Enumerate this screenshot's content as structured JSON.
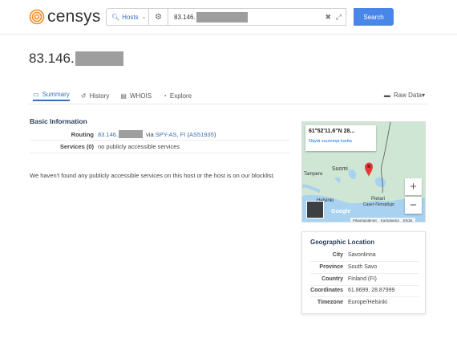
{
  "header": {
    "logo_text": "censys",
    "search_type": "Hosts",
    "query_prefix": "83.146.",
    "search_button": "Search"
  },
  "host": {
    "title_prefix": "83.146."
  },
  "tabs": [
    {
      "label": "Summary",
      "icon": "monitor-icon"
    },
    {
      "label": "History",
      "icon": "history-icon"
    },
    {
      "label": "WHOIS",
      "icon": "whois-icon"
    },
    {
      "label": "Explore",
      "icon": "binoculars-icon"
    }
  ],
  "raw_data": "Raw Data",
  "basic_info": {
    "title": "Basic Information",
    "routing_label": "Routing",
    "routing_ip_prefix": "83.146.",
    "routing_via": "via",
    "routing_asn_name": "SPY-AS, FI",
    "routing_asn_open": "(",
    "routing_asn": "AS51935",
    "routing_asn_close": ")",
    "services_label": "Services (0)",
    "services_value": "no publicly accessible services",
    "notice": "We haven't found any publicly accessible services on this host or the host is on our blocklist."
  },
  "map": {
    "coords": "61°52'11.6\"N 28...",
    "link": "Näytä suurempi kartta",
    "labels": {
      "suomi": "Suomi",
      "tampere": "Tampere",
      "helsinki": "Helsinki",
      "pietari1": "Pietari",
      "pietari2": "Санкт-Петербург",
      "google": "Google"
    },
    "footer": [
      "Pikanäppäimet",
      "Karttatiedot",
      "Ehdot"
    ]
  },
  "geo": {
    "title": "Geographic Location",
    "rows": [
      {
        "k": "City",
        "v": "Savonlinna"
      },
      {
        "k": "Province",
        "v": "South Savo"
      },
      {
        "k": "Country",
        "v": "Finland (FI)"
      },
      {
        "k": "Coordinates",
        "v": "61.8699, 28.87999"
      },
      {
        "k": "Timezone",
        "v": "Europe/Helsinki"
      }
    ]
  },
  "colors": {
    "accent": "#4a86e8",
    "link": "#3a6fb0",
    "heading": "#2a3d5c",
    "logo_orange": "#f28c28"
  }
}
